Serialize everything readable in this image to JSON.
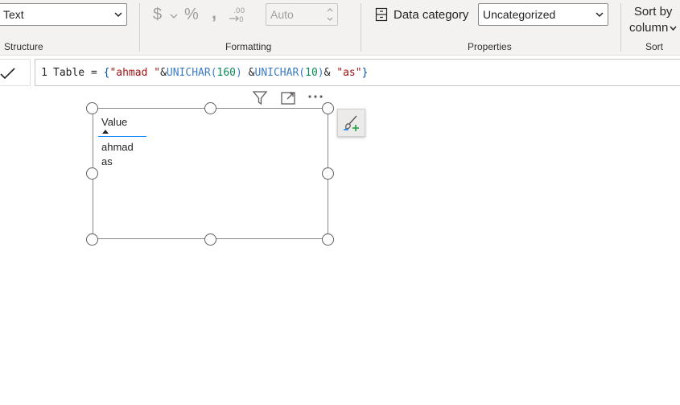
{
  "ribbon": {
    "structure": {
      "data_type_value": "Text",
      "label": "Structure"
    },
    "formatting": {
      "label": "Formatting",
      "decimal_places_placeholder": "Auto",
      "icons": [
        "currency-icon",
        "percent-icon",
        "comma-icon",
        "decimal-icon"
      ]
    },
    "properties": {
      "label": "Properties",
      "data_category_label": "Data category",
      "data_category_value": "Uncategorized"
    },
    "sort": {
      "label": "Sort",
      "sort_by_line1": "Sort by",
      "sort_by_line2": "column"
    }
  },
  "formula_bar": {
    "line_number": "1",
    "name": "Table",
    "operator": " = ",
    "open_brace": "{",
    "str1": "\"ahmad \"",
    "amp1": "&",
    "fn1": "UNICHAR",
    "paren1_open": "(",
    "num1": "160",
    "paren1_close": ")",
    "amp2": " &",
    "fn2": "UNICHAR",
    "paren2_open": "(",
    "num2": "10",
    "paren2_close": ")",
    "amp3": "& ",
    "str2": "\"as\"",
    "close_brace": "}"
  },
  "table_visual": {
    "column_header": "Value",
    "rows": [
      "ahmad",
      "as"
    ]
  },
  "colors": {
    "accent": "#118dff",
    "ribbon_bg": "#f3f2f1"
  }
}
